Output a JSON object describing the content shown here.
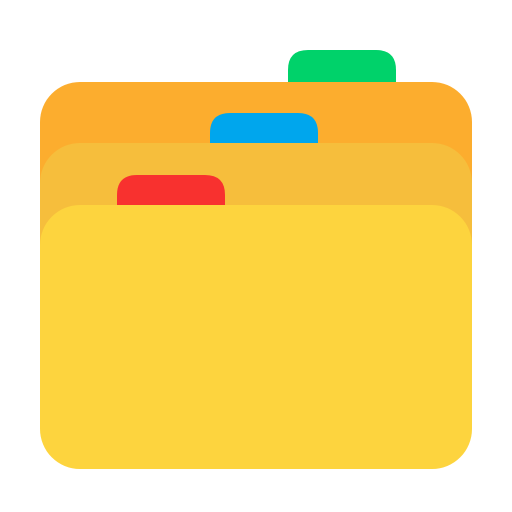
{
  "icon": {
    "name": "folders-icon",
    "colors": {
      "background": "#ffffff",
      "folder_back": "#fcad2e",
      "folder_middle": "#f6be3c",
      "folder_front": "#fdd43e",
      "tab_back": "#00d26a",
      "tab_middle": "#00a6ed",
      "tab_front": "#f8312f"
    }
  }
}
